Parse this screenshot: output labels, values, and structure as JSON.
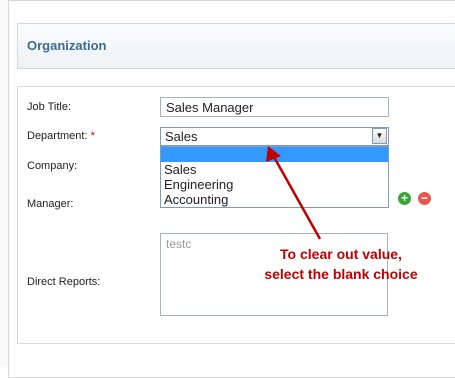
{
  "section": {
    "title": "Organization"
  },
  "form": {
    "job_title_label": "Job Title:",
    "job_title_value": "Sales Manager",
    "department_label": "Department:",
    "required_mark": "*",
    "department_selected": "Sales",
    "department_options": [
      "",
      "Sales",
      "Engineering",
      "Accounting"
    ],
    "company_label": "Company:",
    "manager_label": "Manager:",
    "direct_reports_label": "Direct Reports:",
    "direct_reports_items": [
      "testc"
    ],
    "add_glyph": "+",
    "remove_glyph": "−"
  },
  "annotation": {
    "line1": "To clear out value,",
    "line2": "select the blank choice",
    "color": "#c00000"
  },
  "icons": {
    "dropdown": "dropdown-arrow-icon",
    "add": "plus-icon",
    "remove": "minus-icon",
    "annotation": "arrow-icon"
  }
}
